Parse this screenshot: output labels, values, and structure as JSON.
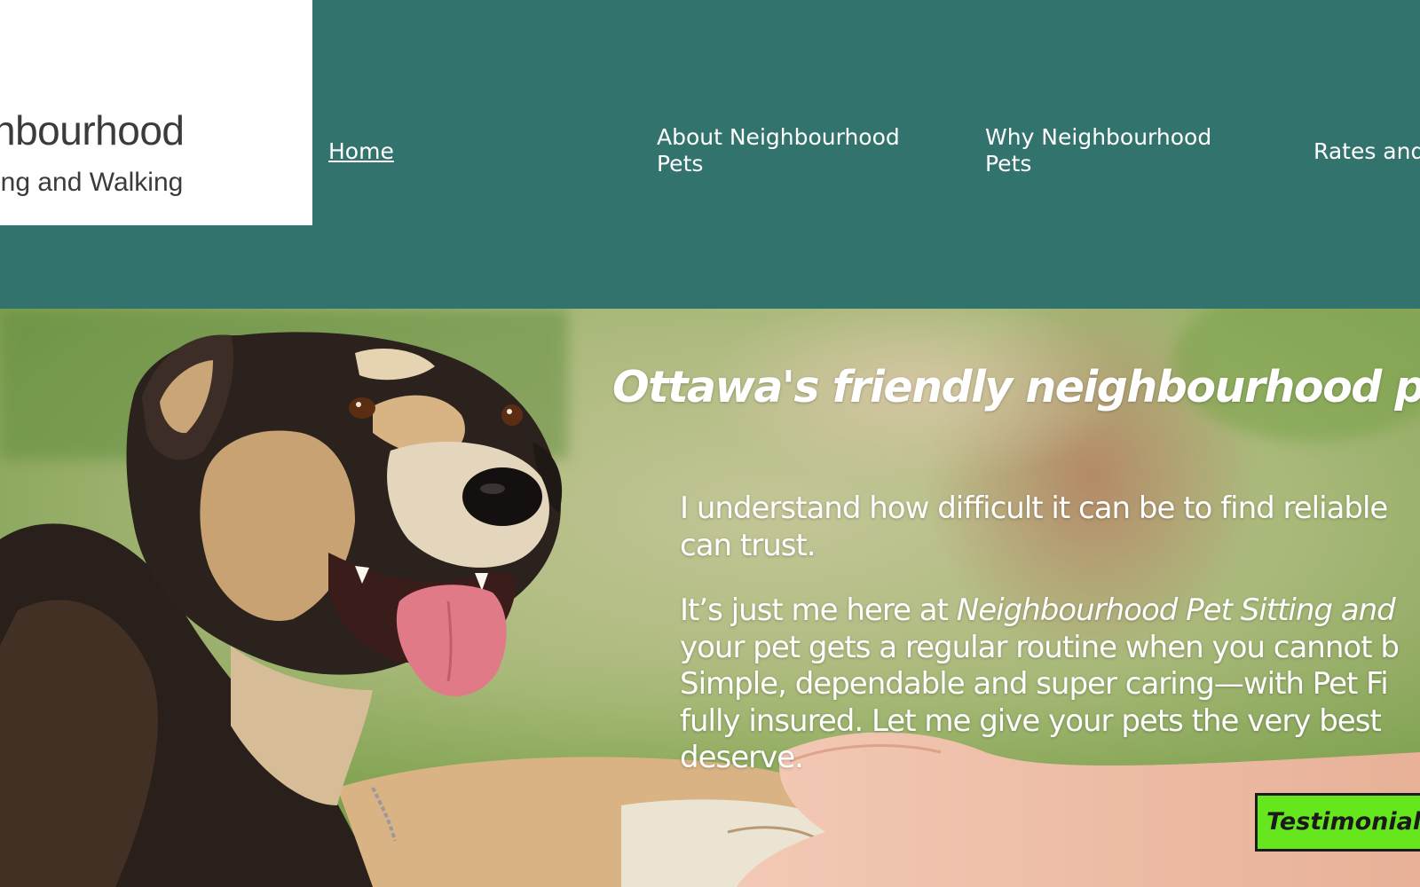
{
  "logo": {
    "line1": "hbourhood",
    "line2": "ing and Walking"
  },
  "nav": {
    "home": "Home",
    "about_line1": "About Neighbourhood",
    "about_line2": "Pets",
    "why_line1": "Why Neighbourhood",
    "why_line2": "Pets",
    "rates": "Rates and"
  },
  "hero": {
    "heading": "Ottawa's friendly neighbourhood pet se",
    "para1_line1": "I understand how difficult it can be to find reliable",
    "para1_line2": "can trust.",
    "para2_line1_start": "It’s just me here at ",
    "para2_line1_italic": "Neighbourhood Pet Sitting and",
    "para2_line2": "your pet gets a regular routine when you cannot b",
    "para2_line3": "Simple, dependable and super caring—with Pet Fi",
    "para2_line4": "fully insured. Let me  give your pets the very best",
    "para2_line5": "deserve.",
    "testimonials_button": "Testimonials"
  },
  "colors": {
    "header_bg": "#33736e",
    "button_bg": "#66e61c"
  },
  "icons": {
    "hero_image": "dog-paw-in-hand-photo"
  }
}
